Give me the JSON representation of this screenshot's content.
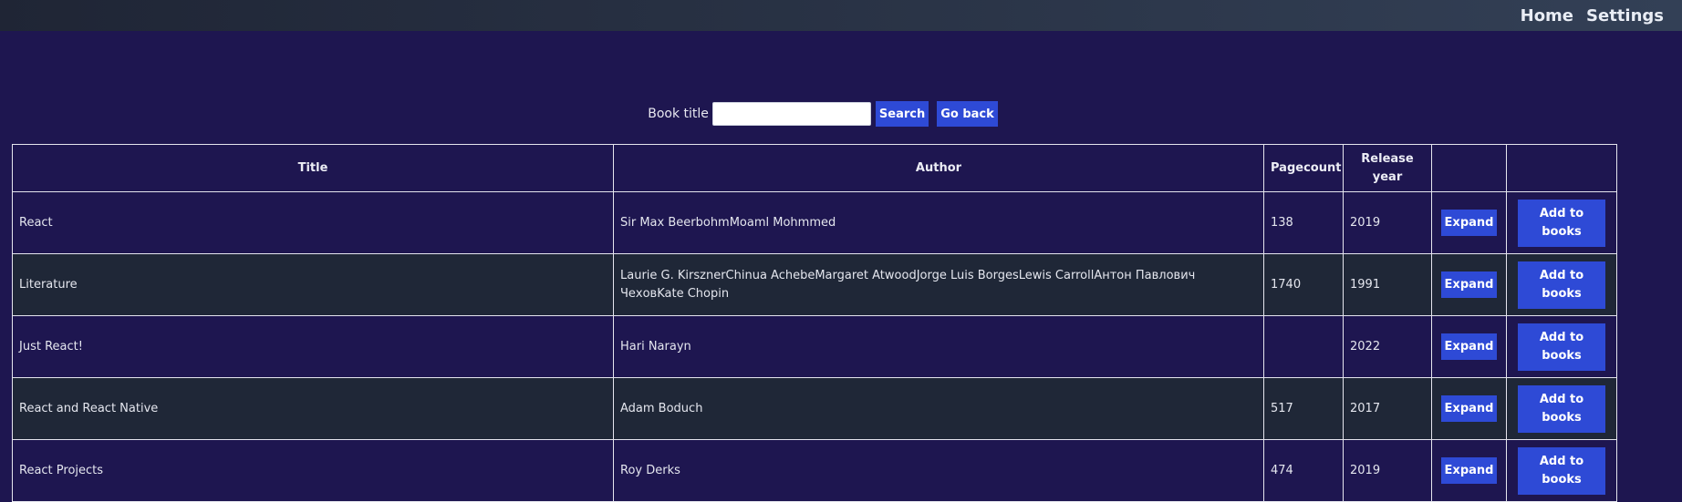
{
  "nav": {
    "home": "Home",
    "settings": "Settings"
  },
  "search": {
    "label": "Book title",
    "value": "",
    "search_button": "Search",
    "back_button": "Go back"
  },
  "table": {
    "headers": {
      "title": "Title",
      "author": "Author",
      "pagecount": "Pagecount",
      "release_year": "Release year",
      "expand": "",
      "add": ""
    },
    "expand_label": "Expand",
    "add_label": "Add to books",
    "rows": [
      {
        "title": "React",
        "author": "Sir Max BeerbohmMoaml Mohmmed",
        "pagecount": "138",
        "year": "2019"
      },
      {
        "title": "Literature",
        "author": "Laurie G. KirsznerChinua AchebeMargaret AtwoodJorge Luis BorgesLewis CarrollАнтон Павлович ЧеховKate Chopin",
        "pagecount": "1740",
        "year": "1991"
      },
      {
        "title": "Just React!",
        "author": "Hari Narayn",
        "pagecount": "",
        "year": "2022"
      },
      {
        "title": "React and React Native",
        "author": "Adam Boduch",
        "pagecount": "517",
        "year": "2017"
      },
      {
        "title": "React Projects",
        "author": "Roy Derks",
        "pagecount": "474",
        "year": "2019"
      }
    ]
  },
  "colors": {
    "background": "#1e1650",
    "row_alt": "#1f2737",
    "button": "#2e4ad6"
  }
}
